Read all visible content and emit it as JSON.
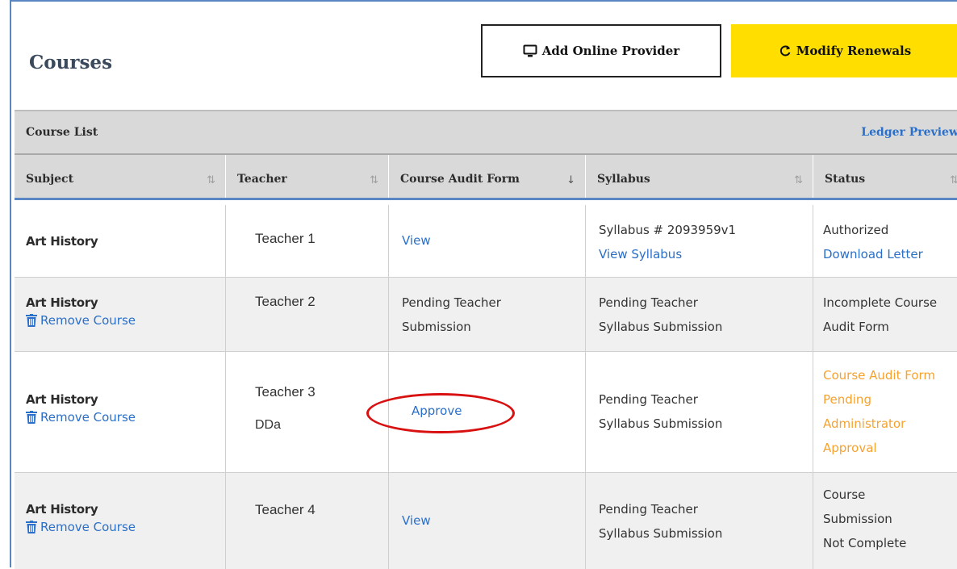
{
  "page": {
    "title": "Courses"
  },
  "buttons": {
    "add_online_provider": "Add Online Provider",
    "modify_renewals": "Modify Renewals"
  },
  "toolbar": {
    "label": "Course List",
    "ledger_preview": "Ledger Preview"
  },
  "columns": [
    "Subject",
    "Teacher",
    "Course Audit Form",
    "Syllabus",
    "Status"
  ],
  "rows": [
    {
      "subject": "Art History",
      "teacher": "Teacher 1",
      "audit": "View",
      "syllabus_line1": "Syllabus # 2093959v1",
      "syllabus_line2": "View Syllabus",
      "status_line1": "Authorized",
      "status_line2": "Download Letter"
    },
    {
      "subject": "Art History",
      "remove": "Remove Course",
      "teacher": "Teacher 2",
      "audit_line1": "Pending Teacher",
      "audit_line2": "Submission",
      "syllabus_line1": "Pending Teacher",
      "syllabus_line2": "Syllabus Submission",
      "status_line1": "Incomplete Course",
      "status_line2": "Audit Form"
    },
    {
      "subject": "Art History",
      "remove": "Remove Course",
      "teacher": "Teacher 3",
      "teacher_extra": "DDa",
      "audit": "Approve",
      "syllabus_line1": "Pending Teacher",
      "syllabus_line2": "Syllabus Submission",
      "status_lines": [
        "Course Audit Form",
        "Pending",
        "Administrator",
        "Approval"
      ]
    },
    {
      "subject": "Art History",
      "remove": "Remove Course",
      "teacher": "Teacher 4",
      "audit": "View",
      "syllabus_line1": "Pending Teacher",
      "syllabus_line2": "Syllabus Submission",
      "status_lines": [
        "Course",
        "Submission",
        "Not Complete"
      ]
    }
  ],
  "colors": {
    "accent_yellow": "#ffde00",
    "link_blue": "#2a6fc9",
    "pending_orange": "#f7a22e",
    "highlight_red": "#d81010"
  }
}
